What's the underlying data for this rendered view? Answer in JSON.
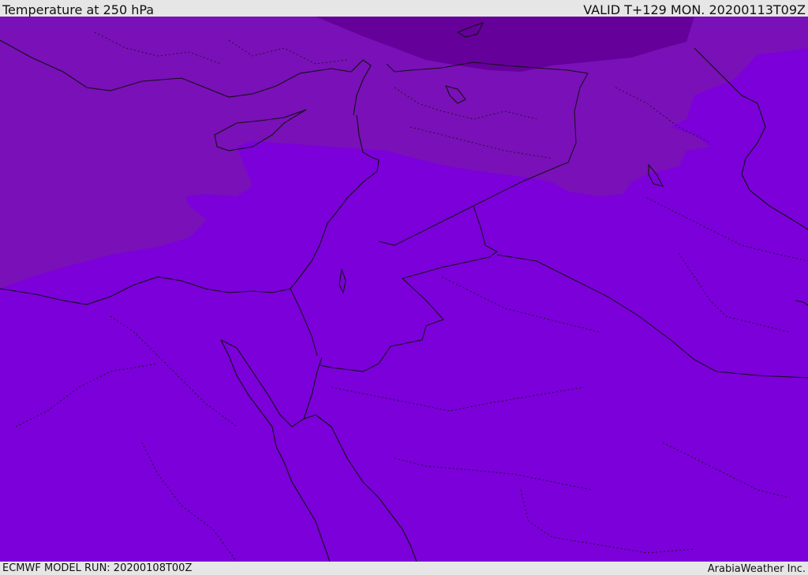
{
  "header": {
    "title": "Temperature at 250 hPa",
    "valid": "VALID T+129 MON. 20200113T09Z"
  },
  "footer": {
    "model_run": "ECMWF MODEL RUN: 20200108T00Z",
    "credit": "ArabiaWeather Inc."
  },
  "map": {
    "colors": {
      "warm_band": "#7b00d9",
      "mid_band": "#7a10b8",
      "cold_band": "#65009a",
      "boundary": "#111111"
    }
  }
}
